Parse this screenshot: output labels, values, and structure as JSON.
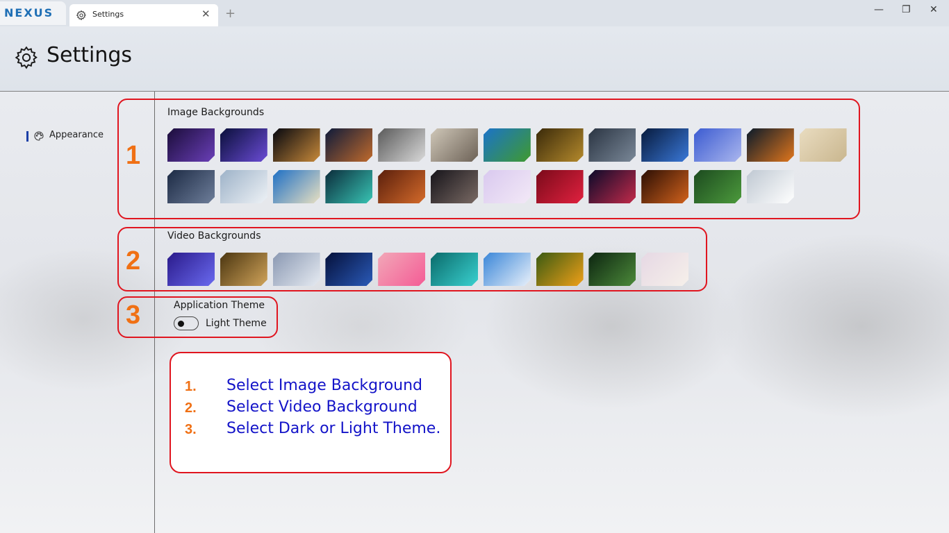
{
  "titlebar": {
    "logo": "NEXUS",
    "tab_title": "Settings",
    "tab_close": "✕",
    "new_tab": "+",
    "minimize": "—",
    "restore": "❐",
    "close": "✕"
  },
  "header": {
    "title": "Settings"
  },
  "sidebar": {
    "items": [
      {
        "label": "Appearance",
        "icon": "palette-icon",
        "active": true
      }
    ]
  },
  "annotations": {
    "n1": "1",
    "n2": "2",
    "n3": "3"
  },
  "image_backgrounds": {
    "title": "Image Backgrounds",
    "items": [
      {
        "name": "purple bokeh",
        "colors": [
          "#1b0d3a",
          "#6a3fb8"
        ]
      },
      {
        "name": "purple light beam",
        "colors": [
          "#0a0f3a",
          "#6b4cd6"
        ]
      },
      {
        "name": "night city waterfront",
        "colors": [
          "#05070f",
          "#c98a3a"
        ]
      },
      {
        "name": "canal city night",
        "colors": [
          "#0d1a3a",
          "#c06a2c"
        ]
      },
      {
        "name": "grey wave",
        "colors": [
          "#5a5a5a",
          "#d9d9d9"
        ]
      },
      {
        "name": "chess piece",
        "colors": [
          "#cfc7b8",
          "#6d6257"
        ]
      },
      {
        "name": "green field blue sky",
        "colors": [
          "#1b73c9",
          "#3f9a2e"
        ]
      },
      {
        "name": "water drop golden",
        "colors": [
          "#3a2a0a",
          "#b58a2c"
        ]
      },
      {
        "name": "dark pyramid",
        "colors": [
          "#2a3442",
          "#7a8898"
        ]
      },
      {
        "name": "blue butterflies",
        "colors": [
          "#071a3c",
          "#3a78d8"
        ]
      },
      {
        "name": "blue flower",
        "colors": [
          "#3b5bd1",
          "#aab6ee"
        ]
      },
      {
        "name": "fire and water",
        "colors": [
          "#0a1a2a",
          "#e1761c"
        ]
      },
      {
        "name": "red poppy field",
        "colors": [
          "#e9dcc0",
          "#c9b68e"
        ]
      },
      {
        "name": "sunset reflection",
        "colors": [
          "#1c2a44",
          "#6e7e9a"
        ]
      },
      {
        "name": "winter snow trees",
        "colors": [
          "#9db2c8",
          "#eef2f6"
        ]
      },
      {
        "name": "tropical beach",
        "colors": [
          "#1e6fc4",
          "#e9e0c2"
        ]
      },
      {
        "name": "aurora",
        "colors": [
          "#0b2b3a",
          "#38c4b4"
        ]
      },
      {
        "name": "antelope canyon",
        "colors": [
          "#5a1f0c",
          "#d46a2a"
        ]
      },
      {
        "name": "rock arch night",
        "colors": [
          "#16141a",
          "#7a6a64"
        ]
      },
      {
        "name": "pink flowers",
        "colors": [
          "#d9c9ef",
          "#f3e9f7"
        ]
      },
      {
        "name": "red roses",
        "colors": [
          "#7a0a1a",
          "#e1213f"
        ]
      },
      {
        "name": "kaleidoscope",
        "colors": [
          "#0a0a2a",
          "#c22a4a"
        ]
      },
      {
        "name": "fire tunnel",
        "colors": [
          "#2a0e04",
          "#d2621c"
        ]
      },
      {
        "name": "tulip green",
        "colors": [
          "#1c4a1f",
          "#4c9a3c"
        ]
      },
      {
        "name": "white light",
        "colors": [
          "#bfc8d2",
          "#ffffff"
        ]
      }
    ]
  },
  "video_backgrounds": {
    "title": "Video Backgrounds",
    "items": [
      {
        "name": "purple bokeh",
        "colors": [
          "#2a1a8a",
          "#6a6af0"
        ]
      },
      {
        "name": "gold tiles",
        "colors": [
          "#4a3510",
          "#d1a45a"
        ]
      },
      {
        "name": "white waves",
        "colors": [
          "#8a98b2",
          "#e6ebf2"
        ]
      },
      {
        "name": "space nebula",
        "colors": [
          "#05103a",
          "#2a5ab8"
        ]
      },
      {
        "name": "pink glow",
        "colors": [
          "#f2a8b8",
          "#f45b95"
        ]
      },
      {
        "name": "tropical lagoon",
        "colors": [
          "#0a6a6a",
          "#3ad1d0"
        ]
      },
      {
        "name": "blue sky clouds",
        "colors": [
          "#3a86d8",
          "#e8f0fa"
        ]
      },
      {
        "name": "orange flowers",
        "colors": [
          "#3a5a12",
          "#f0a018"
        ]
      },
      {
        "name": "green leaf",
        "colors": [
          "#0c2410",
          "#4c8a3a"
        ]
      },
      {
        "name": "soft pastel",
        "colors": [
          "#e6d8e4",
          "#f6f0ea"
        ]
      }
    ]
  },
  "theme": {
    "title": "Application Theme",
    "toggle_label": "Light Theme",
    "is_dark": false
  },
  "instructions": {
    "steps": [
      {
        "num": "1.",
        "text": "Select Image Background"
      },
      {
        "num": "2.",
        "text": "Select Video Background"
      },
      {
        "num": "3.",
        "text": "Select Dark or Light Theme."
      }
    ]
  }
}
